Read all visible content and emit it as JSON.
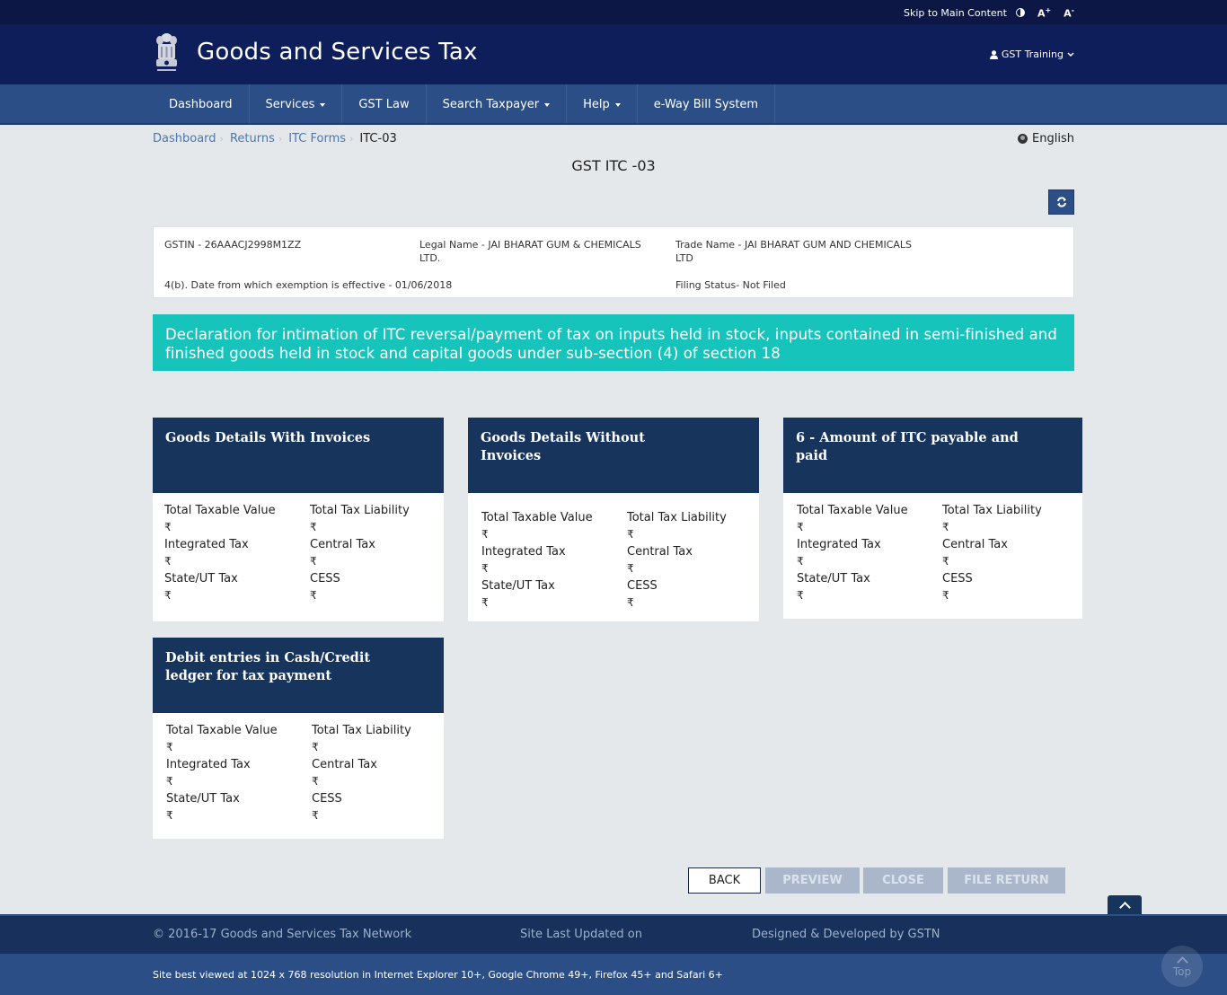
{
  "topbar": {
    "skip_label": "Skip to Main Content",
    "font_increase": "A",
    "font_increase_sup": "+",
    "font_decrease": "A",
    "font_decrease_sup": "-"
  },
  "header": {
    "title": "Goods and Services Tax",
    "user_label": "GST Training"
  },
  "nav": {
    "items": [
      {
        "label": "Dashboard",
        "dropdown": false
      },
      {
        "label": "Services",
        "dropdown": true
      },
      {
        "label": "GST Law",
        "dropdown": false
      },
      {
        "label": "Search Taxpayer",
        "dropdown": true
      },
      {
        "label": "Help",
        "dropdown": true
      },
      {
        "label": "e-Way Bill System",
        "dropdown": false
      }
    ]
  },
  "breadcrumb": {
    "items": [
      "Dashboard",
      "Returns",
      "ITC Forms"
    ],
    "current": "ITC-03"
  },
  "language": "English",
  "page_title": "GST ITC -03",
  "info": {
    "gstin": "GSTIN - 26AAACJ2998M1ZZ",
    "legal_name_line1": "Legal Name - JAI BHARAT GUM & CHEMICALS",
    "legal_name_line2": "LTD.",
    "trade_name_line1": "Trade Name - JAI BHARAT GUM AND CHEMICALS",
    "trade_name_line2": "LTD",
    "exemption_date": "4(b). Date from which exemption is effective - 01/06/2018",
    "filing_status": "Filing Status- Not Filed"
  },
  "banner": "Declaration for intimation of ITC reversal/payment of tax on inputs held in stock, inputs contained in semi-finished and finished goods held in stock and capital goods under sub-section (4) of section 18",
  "cards": [
    {
      "title": "Goods Details With Invoices",
      "fields": [
        {
          "label": "Total Taxable Value",
          "value": "₹"
        },
        {
          "label": "Total Tax Liability",
          "value": "₹"
        },
        {
          "label": "Integrated Tax",
          "value": "₹"
        },
        {
          "label": "Central Tax",
          "value": "₹"
        },
        {
          "label": "State/UT Tax",
          "value": "₹"
        },
        {
          "label": "CESS",
          "value": "₹"
        }
      ]
    },
    {
      "title": "Goods Details Without Invoices",
      "fields": [
        {
          "label": "Total Taxable Value",
          "value": "₹"
        },
        {
          "label": "Total Tax Liability",
          "value": "₹"
        },
        {
          "label": "Integrated Tax",
          "value": "₹"
        },
        {
          "label": "Central Tax",
          "value": "₹"
        },
        {
          "label": "State/UT Tax",
          "value": "₹"
        },
        {
          "label": "CESS",
          "value": "₹"
        }
      ]
    },
    {
      "title": "6 - Amount of ITC payable and paid",
      "fields": [
        {
          "label": "Total Taxable Value",
          "value": "₹"
        },
        {
          "label": "Total Tax Liability",
          "value": "₹"
        },
        {
          "label": "Integrated Tax",
          "value": "₹"
        },
        {
          "label": "Central Tax",
          "value": "₹"
        },
        {
          "label": "State/UT Tax",
          "value": "₹"
        },
        {
          "label": "CESS",
          "value": "₹"
        }
      ]
    },
    {
      "title": "Debit entries in Cash/Credit ledger for tax payment",
      "fields": [
        {
          "label": "Total Taxable Value",
          "value": "₹"
        },
        {
          "label": "Total Tax Liability",
          "value": "₹"
        },
        {
          "label": "Integrated Tax",
          "value": "₹"
        },
        {
          "label": "Central Tax",
          "value": "₹"
        },
        {
          "label": "State/UT Tax",
          "value": "₹"
        },
        {
          "label": "CESS",
          "value": "₹"
        }
      ]
    }
  ],
  "actions": {
    "back": "BACK",
    "preview": "PREVIEW",
    "close": "CLOSE",
    "file_return": "FILE RETURN"
  },
  "footer": {
    "copyright": "© 2016-17 Goods and Services Tax Network",
    "last_updated": "Site Last Updated on",
    "developed_by": "Designed & Developed by GSTN",
    "browser_note": "Site best viewed at 1024 x 768 resolution in Internet Explorer 10+, Google Chrome 49+, Firefox 45+ and Safari 6+",
    "top_label": "Top"
  },
  "colors": {
    "header_bg": "#0e1e5b",
    "nav_bg": "#2c4e86",
    "banner_bg": "#17c4bb",
    "card_head_bg": "#17355c",
    "disabled_btn_bg": "#aab7cb"
  }
}
